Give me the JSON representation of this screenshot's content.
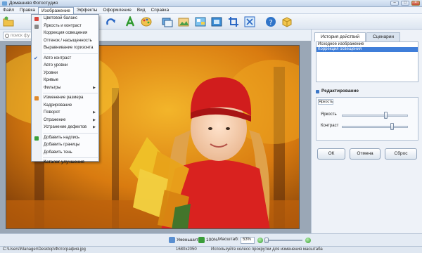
{
  "window": {
    "title": "Домашняя Фотостудия"
  },
  "menu": [
    "Файл",
    "Правка",
    "Изображение",
    "Эффекты",
    "Оформление",
    "Вид",
    "Справка"
  ],
  "menu_active_index": 2,
  "search": {
    "placeholder": "поиск фу"
  },
  "image_menu": {
    "items": [
      {
        "label": "Цветовой баланс",
        "icon": "color-balance-icon",
        "color": "#d9443b"
      },
      {
        "label": "Яркость и контраст",
        "icon": "brightness-contrast-icon",
        "color": "#888888"
      },
      {
        "label": "Коррекция освещения",
        "icon": "",
        "color": ""
      },
      {
        "label": "Оттенок / насыщенность",
        "icon": "",
        "color": ""
      },
      {
        "label": "Выравнивание горизонта",
        "icon": "",
        "color": ""
      },
      {
        "label": "Авто контраст",
        "icon": "check-icon",
        "color": "#2b5fb3"
      },
      {
        "label": "Авто уровни",
        "icon": "",
        "color": ""
      },
      {
        "label": "Уровни",
        "icon": "",
        "color": ""
      },
      {
        "label": "Кривые",
        "icon": "",
        "color": ""
      },
      {
        "label": "Фильтры",
        "icon": "",
        "color": "",
        "submenu": true
      },
      {
        "label": "Изменение размера",
        "icon": "resize-icon",
        "color": "#e08a2c"
      },
      {
        "label": "Кадрирование",
        "icon": "",
        "color": ""
      },
      {
        "label": "Поворот",
        "icon": "",
        "color": "",
        "submenu": true
      },
      {
        "label": "Отражение",
        "icon": "",
        "color": "",
        "submenu": true
      },
      {
        "label": "Устранение дефектов",
        "icon": "",
        "color": "",
        "submenu": true
      },
      {
        "label": "Добавить надпись",
        "icon": "text-icon",
        "color": "#3aa03a"
      },
      {
        "label": "Добавить границы",
        "icon": "",
        "color": ""
      },
      {
        "label": "Добавить тень",
        "icon": "",
        "color": ""
      },
      {
        "label": "Каталог улучшения",
        "icon": "",
        "color": "",
        "bold": true
      }
    ]
  },
  "status": {
    "shrink_label": "Уменьшить",
    "hundred_label": "100%",
    "scale_label": "Масштаб:",
    "scale_value": "53%",
    "zoom_fraction": 0.05,
    "path": "C:\\Users\\Manager\\Desktop\\Фотография.jpg",
    "dimensions": "1680x2050",
    "hint": "Используйте колесо прокрутки для изменения масштаба"
  },
  "panel": {
    "tabs": [
      "История действий",
      "Сценарии"
    ],
    "history": [
      "Исходное изображение",
      "Коррекция освещения"
    ],
    "history_selected": 1,
    "edit_title": "Редактирование",
    "subtab": "Яркость",
    "sliders": [
      {
        "label": "Яркость",
        "value": 0.66
      },
      {
        "label": "Контраст",
        "value": 0.76
      }
    ],
    "buttons": {
      "ok": "ОК",
      "cancel": "Отмена",
      "reset": "Сброс"
    }
  },
  "colors": {
    "accent": "#3f7ed9",
    "selection": "#3f7ed9"
  }
}
